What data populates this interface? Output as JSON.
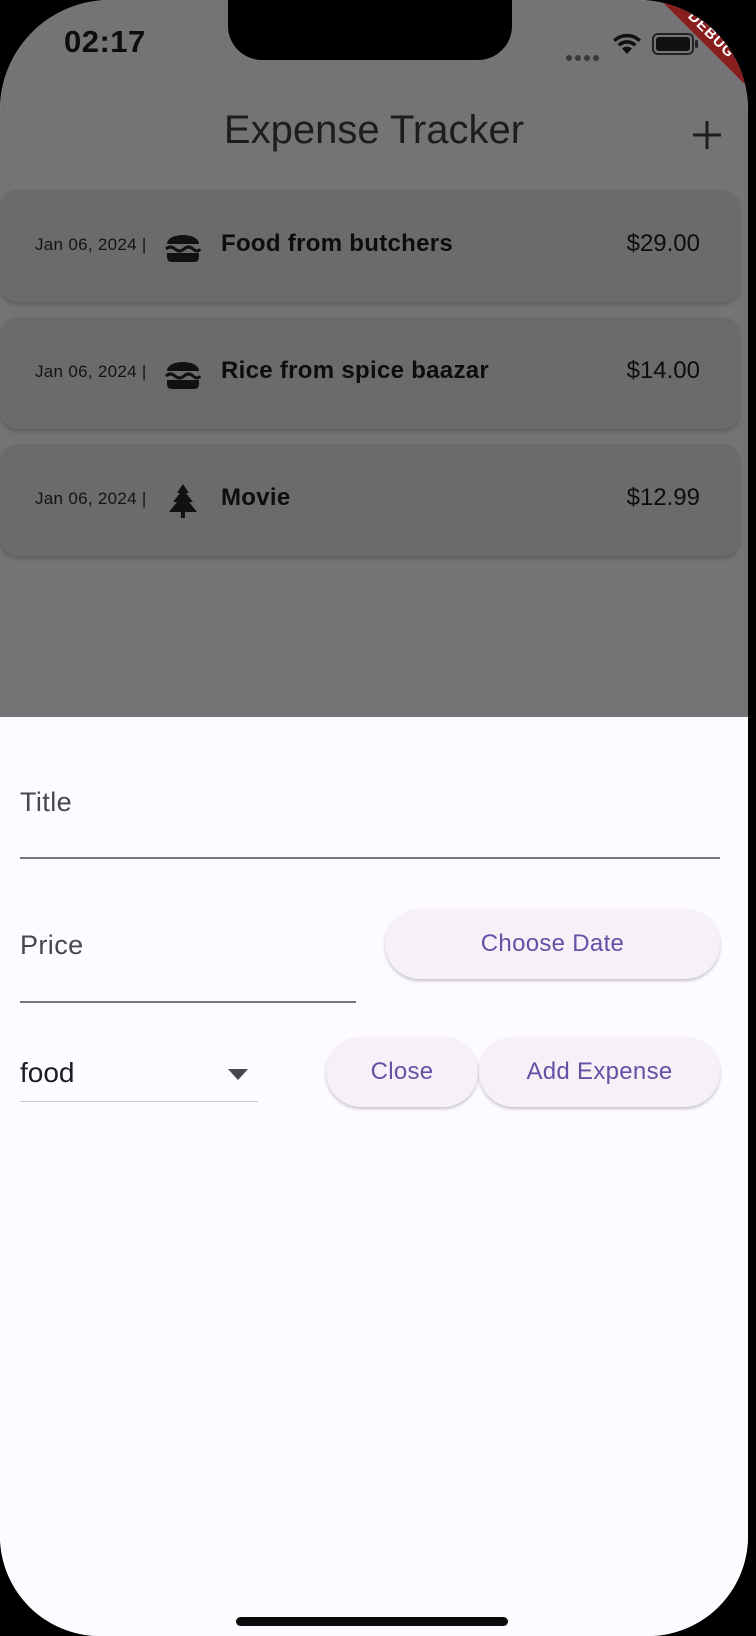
{
  "status_bar": {
    "time": "02:17",
    "icons": [
      "signal-icon",
      "wifi-icon",
      "battery-icon"
    ],
    "debug_label": "DEBUG"
  },
  "app_bar": {
    "title": "Expense Tracker",
    "action_icon": "add-icon"
  },
  "expenses": [
    {
      "date": "Jan 06, 2024 |",
      "icon": "burger-icon",
      "title": "Food from butchers",
      "amount": "$29.00"
    },
    {
      "date": "Jan 06, 2024 |",
      "icon": "burger-icon",
      "title": "Rice from spice baazar",
      "amount": "$14.00"
    },
    {
      "date": "Jan 06, 2024 |",
      "icon": "tree-icon",
      "title": "Movie",
      "amount": "$12.99"
    }
  ],
  "form": {
    "title_label": "Title",
    "price_label": "Price",
    "choose_date_label": "Choose Date",
    "category_value": "food",
    "close_label": "Close",
    "add_expense_label": "Add Expense"
  },
  "colors": {
    "accent": "#6750a4",
    "scrim": "#767376",
    "sheet_background": "#fdfbff",
    "debug_banner": "#8a1e1e"
  }
}
